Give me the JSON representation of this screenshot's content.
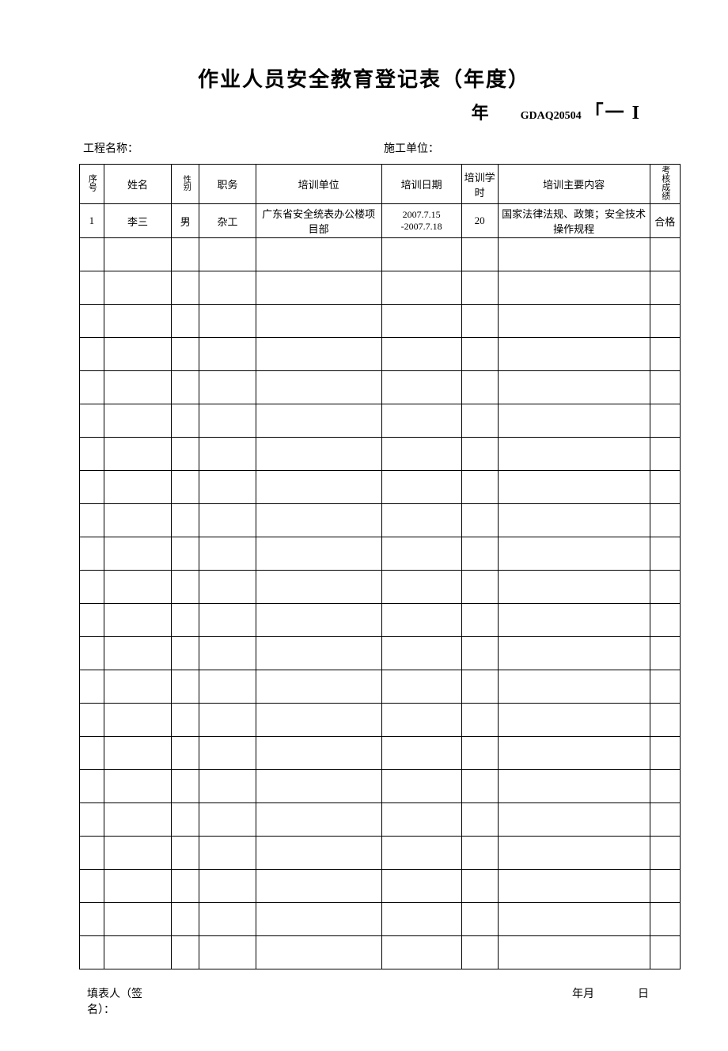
{
  "title": "作业人员安全教育登记表（年度）",
  "year_label": "年",
  "code_label": "GDAQ20504",
  "bracket_text": "「一 I",
  "info": {
    "project_label": "工程名称：",
    "unit_label": "施工单位："
  },
  "headers": {
    "seq": "序号",
    "name": "姓名",
    "gender": "性别",
    "job": "职务",
    "unit": "培训单位",
    "date": "培训日期",
    "hours": "培训学时",
    "content": "培训主要内容",
    "result": "考核成绩"
  },
  "rows": [
    {
      "seq": "1",
      "name": "李三",
      "gender": "男",
      "job": "杂工",
      "unit": "广东省安全统表办公楼项目部",
      "date": "2007.7.15 -2007.7.18",
      "hours": "20",
      "content": "国家法律法规、政策；安全技术操作规程",
      "result": "合格"
    }
  ],
  "empty_row_count": 22,
  "footer": {
    "filler_label": "填表人（签名）：",
    "year_month": "年月",
    "day": "日"
  }
}
